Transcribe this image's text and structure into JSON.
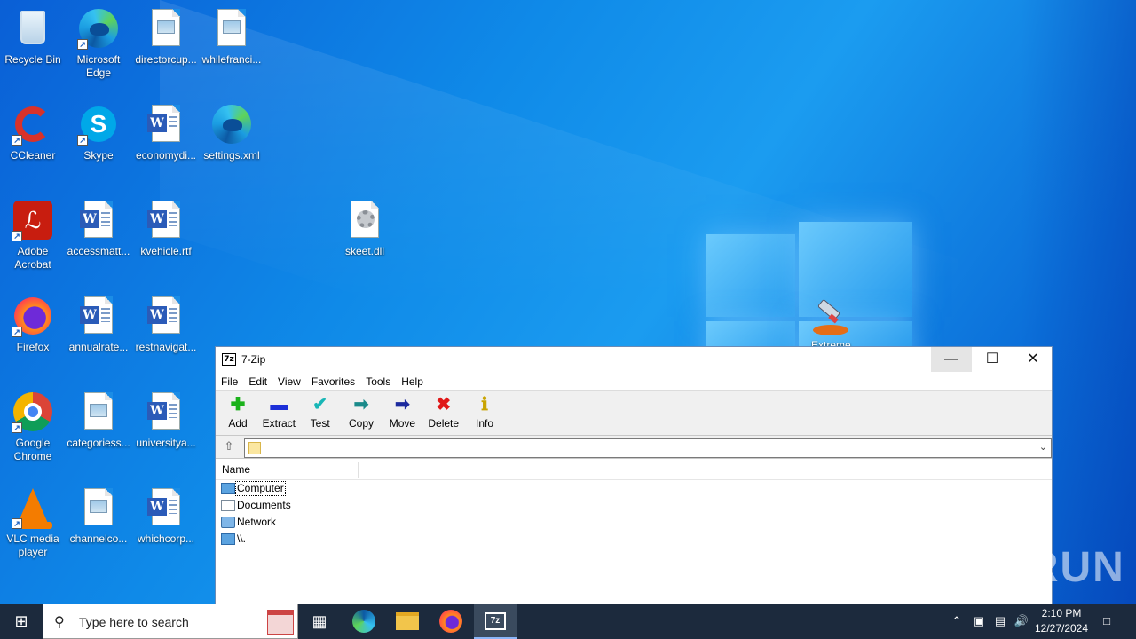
{
  "desktop": {
    "icons": [
      {
        "label": "Recycle Bin"
      },
      {
        "label": "Microsoft Edge"
      },
      {
        "label": "directorcup..."
      },
      {
        "label": "whilefranci..."
      },
      {
        "label": "CCleaner"
      },
      {
        "label": "Skype"
      },
      {
        "label": "economydi..."
      },
      {
        "label": "settings.xml"
      },
      {
        "label": "Adobe Acrobat"
      },
      {
        "label": "accessmatt..."
      },
      {
        "label": "kvehicle.rtf"
      },
      {
        "label": "skeet.dll"
      },
      {
        "label": "Firefox"
      },
      {
        "label": "annualrate..."
      },
      {
        "label": "restnavigat..."
      },
      {
        "label": "Google Chrome"
      },
      {
        "label": "categoriess..."
      },
      {
        "label": "universitya..."
      },
      {
        "label": "VLC media player"
      },
      {
        "label": "channelco..."
      },
      {
        "label": "whichcorp..."
      }
    ],
    "extreme_label": "Extreme"
  },
  "window": {
    "title": "7-Zip",
    "app_icon": "7z",
    "menu": [
      "File",
      "Edit",
      "View",
      "Favorites",
      "Tools",
      "Help"
    ],
    "toolbar": [
      {
        "label": "Add",
        "icon": "add-icon",
        "glyph": "✚",
        "color": "#1bb21b"
      },
      {
        "label": "Extract",
        "icon": "extract-icon",
        "glyph": "▬",
        "color": "#1c2fd8"
      },
      {
        "label": "Test",
        "icon": "test-icon",
        "glyph": "✔",
        "color": "#18b6b6"
      },
      {
        "label": "Copy",
        "icon": "copy-icon",
        "glyph": "➡",
        "color": "#1a8a8a"
      },
      {
        "label": "Move",
        "icon": "move-icon",
        "glyph": "➡",
        "color": "#1c2a9e"
      },
      {
        "label": "Delete",
        "icon": "delete-icon",
        "glyph": "✖",
        "color": "#e01818"
      },
      {
        "label": "Info",
        "icon": "info-icon",
        "glyph": "ℹ",
        "color": "#c9a400"
      }
    ],
    "address": "",
    "list_header": "Name",
    "items": [
      {
        "label": "Computer",
        "icon": "computer-icon"
      },
      {
        "label": "Documents",
        "icon": "documents-icon"
      },
      {
        "label": "Network",
        "icon": "network-icon"
      },
      {
        "label": "\\\\.",
        "icon": "computer-icon"
      }
    ]
  },
  "watermark": "ANY RUN",
  "taskbar": {
    "search_placeholder": "Type here to search",
    "time": "2:10 PM",
    "date": "12/27/2024"
  }
}
